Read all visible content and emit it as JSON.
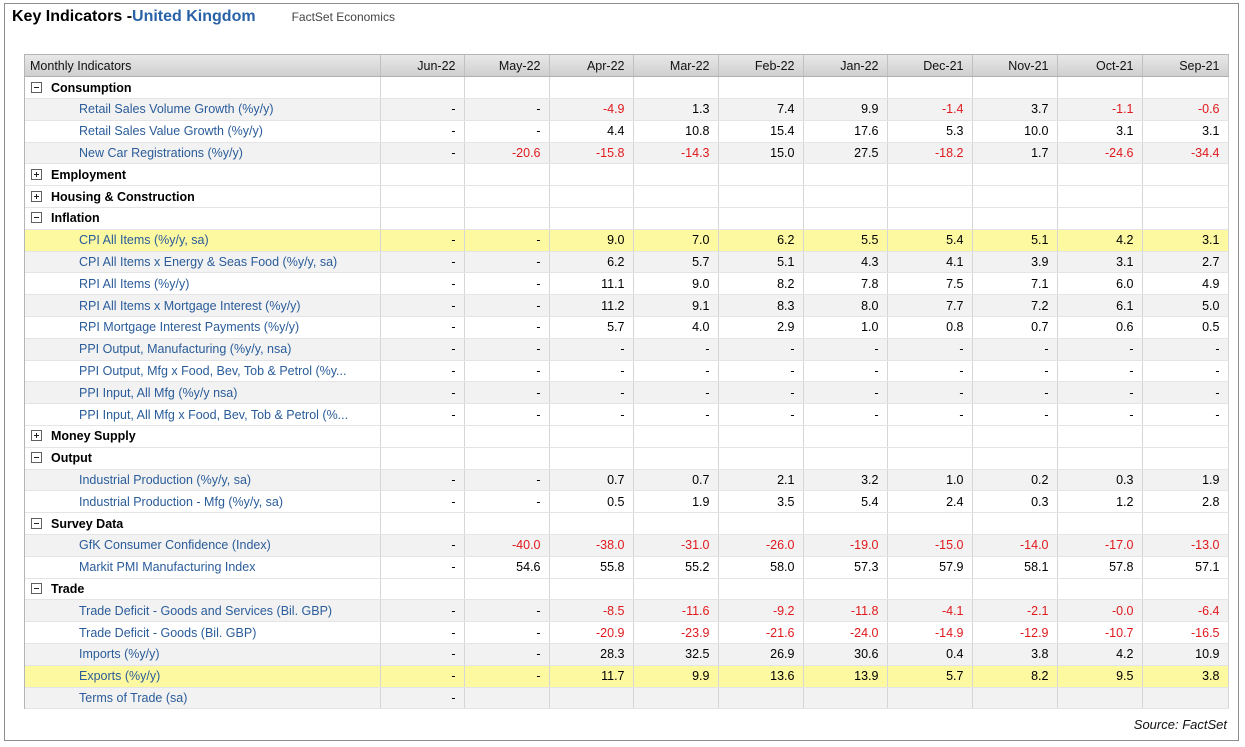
{
  "header": {
    "title": "Key Indicators - ",
    "country": "United Kingdom",
    "provider": "FactSet Economics"
  },
  "table": {
    "label_header": "Monthly Indicators",
    "columns": [
      "Jun-22",
      "May-22",
      "Apr-22",
      "Mar-22",
      "Feb-22",
      "Jan-22",
      "Dec-21",
      "Nov-21",
      "Oct-21",
      "Sep-21"
    ],
    "rows": [
      {
        "type": "group",
        "label": "Consumption",
        "expanded": true
      },
      {
        "type": "item",
        "label": "Retail Sales Volume Growth (%y/y)",
        "values": [
          "-",
          "-",
          "-4.9",
          "1.3",
          "7.4",
          "9.9",
          "-1.4",
          "3.7",
          "-1.1",
          "-0.6"
        ]
      },
      {
        "type": "item",
        "label": "Retail Sales Value Growth (%y/y)",
        "values": [
          "-",
          "-",
          "4.4",
          "10.8",
          "15.4",
          "17.6",
          "5.3",
          "10.0",
          "3.1",
          "3.1"
        ]
      },
      {
        "type": "item",
        "label": "New Car Registrations (%y/y)",
        "values": [
          "-",
          "-20.6",
          "-15.8",
          "-14.3",
          "15.0",
          "27.5",
          "-18.2",
          "1.7",
          "-24.6",
          "-34.4"
        ]
      },
      {
        "type": "group",
        "label": "Employment",
        "expanded": false
      },
      {
        "type": "group",
        "label": "Housing & Construction",
        "expanded": false
      },
      {
        "type": "group",
        "label": "Inflation",
        "expanded": true
      },
      {
        "type": "item",
        "label": "CPI All Items (%y/y, sa)",
        "highlight": true,
        "values": [
          "-",
          "-",
          "9.0",
          "7.0",
          "6.2",
          "5.5",
          "5.4",
          "5.1",
          "4.2",
          "3.1"
        ]
      },
      {
        "type": "item",
        "label": "CPI All Items x Energy & Seas Food (%y/y, sa)",
        "values": [
          "-",
          "-",
          "6.2",
          "5.7",
          "5.1",
          "4.3",
          "4.1",
          "3.9",
          "3.1",
          "2.7"
        ]
      },
      {
        "type": "item",
        "label": "RPI All Items (%y/y)",
        "values": [
          "-",
          "-",
          "11.1",
          "9.0",
          "8.2",
          "7.8",
          "7.5",
          "7.1",
          "6.0",
          "4.9"
        ]
      },
      {
        "type": "item",
        "label": "RPI All Items x Mortgage Interest (%y/y)",
        "values": [
          "-",
          "-",
          "11.2",
          "9.1",
          "8.3",
          "8.0",
          "7.7",
          "7.2",
          "6.1",
          "5.0"
        ]
      },
      {
        "type": "item",
        "label": "RPI Mortgage Interest Payments (%y/y)",
        "values": [
          "-",
          "-",
          "5.7",
          "4.0",
          "2.9",
          "1.0",
          "0.8",
          "0.7",
          "0.6",
          "0.5"
        ]
      },
      {
        "type": "item",
        "label": "PPI Output, Manufacturing (%y/y, nsa)",
        "values": [
          "-",
          "-",
          "-",
          "-",
          "-",
          "-",
          "-",
          "-",
          "-",
          "-"
        ]
      },
      {
        "type": "item",
        "label": "PPI Output, Mfg x Food, Bev, Tob & Petrol (%y...",
        "values": [
          "-",
          "-",
          "-",
          "-",
          "-",
          "-",
          "-",
          "-",
          "-",
          "-"
        ]
      },
      {
        "type": "item",
        "label": "PPI Input, All Mfg (%y/y nsa)",
        "values": [
          "-",
          "-",
          "-",
          "-",
          "-",
          "-",
          "-",
          "-",
          "-",
          "-"
        ]
      },
      {
        "type": "item",
        "label": "PPI Input, All Mfg x Food, Bev, Tob & Petrol (%...",
        "values": [
          "-",
          "-",
          "-",
          "-",
          "-",
          "-",
          "-",
          "-",
          "-",
          "-"
        ]
      },
      {
        "type": "group",
        "label": "Money Supply",
        "expanded": false
      },
      {
        "type": "group",
        "label": "Output",
        "expanded": true
      },
      {
        "type": "item",
        "label": "Industrial Production (%y/y, sa)",
        "values": [
          "-",
          "-",
          "0.7",
          "0.7",
          "2.1",
          "3.2",
          "1.0",
          "0.2",
          "0.3",
          "1.9"
        ]
      },
      {
        "type": "item",
        "label": "Industrial Production - Mfg (%y/y, sa)",
        "values": [
          "-",
          "-",
          "0.5",
          "1.9",
          "3.5",
          "5.4",
          "2.4",
          "0.3",
          "1.2",
          "2.8"
        ]
      },
      {
        "type": "group",
        "label": "Survey Data",
        "expanded": true
      },
      {
        "type": "item",
        "label": "GfK Consumer Confidence (Index)",
        "values": [
          "-",
          "-40.0",
          "-38.0",
          "-31.0",
          "-26.0",
          "-19.0",
          "-15.0",
          "-14.0",
          "-17.0",
          "-13.0"
        ]
      },
      {
        "type": "item",
        "label": "Markit PMI Manufacturing Index",
        "values": [
          "-",
          "54.6",
          "55.8",
          "55.2",
          "58.0",
          "57.3",
          "57.9",
          "58.1",
          "57.8",
          "57.1"
        ]
      },
      {
        "type": "group",
        "label": "Trade",
        "expanded": true
      },
      {
        "type": "item",
        "label": "Trade Deficit - Goods and Services (Bil. GBP)",
        "values": [
          "-",
          "-",
          "-8.5",
          "-11.6",
          "-9.2",
          "-11.8",
          "-4.1",
          "-2.1",
          "-0.0",
          "-6.4"
        ]
      },
      {
        "type": "item",
        "label": "Trade Deficit - Goods (Bil. GBP)",
        "values": [
          "-",
          "-",
          "-20.9",
          "-23.9",
          "-21.6",
          "-24.0",
          "-14.9",
          "-12.9",
          "-10.7",
          "-16.5"
        ]
      },
      {
        "type": "item",
        "label": "Imports (%y/y)",
        "values": [
          "-",
          "-",
          "28.3",
          "32.5",
          "26.9",
          "30.6",
          "0.4",
          "3.8",
          "4.2",
          "10.9"
        ]
      },
      {
        "type": "item",
        "label": "Exports (%y/y)",
        "highlight": true,
        "values": [
          "-",
          "-",
          "11.7",
          "9.9",
          "13.6",
          "13.9",
          "5.7",
          "8.2",
          "9.5",
          "3.8"
        ]
      },
      {
        "type": "item",
        "label": "Terms of Trade (sa)",
        "values": [
          "-",
          "",
          "",
          "",
          "",
          "",
          "",
          "",
          "",
          ""
        ]
      }
    ]
  },
  "footer": {
    "source": "Source: FactSet"
  },
  "colors": {
    "country_blue": "#2a62a8",
    "item_link_blue": "#2a5c9a",
    "negative_red": "#e0191d",
    "highlight_yellow": "#fdf9a0"
  }
}
